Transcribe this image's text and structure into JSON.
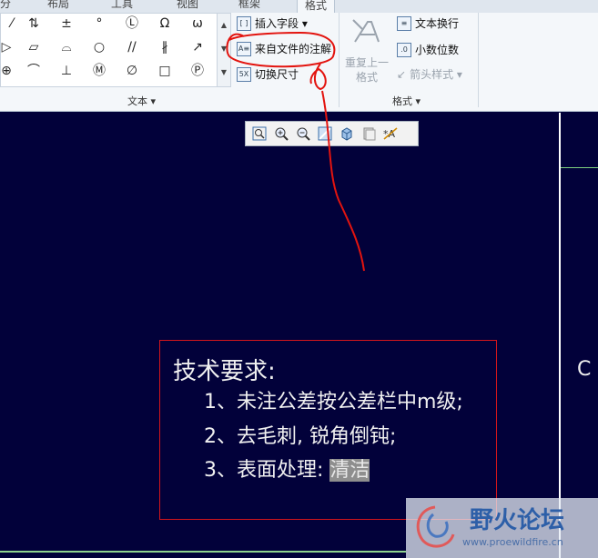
{
  "tabs": [
    "分",
    "布局",
    "工具",
    "视图",
    "框架",
    "格式"
  ],
  "gallery_symbols": [
    [
      "⁄",
      "⇅",
      "±",
      "°",
      "Ⓛ",
      "Ω",
      "ω"
    ],
    [
      "▷",
      "▱",
      "⌓",
      "○",
      "//",
      "∦",
      "↗"
    ],
    [
      "⊕",
      "⌒",
      "⊥",
      "Ⓜ",
      "∅",
      "□",
      "Ⓟ"
    ]
  ],
  "group_text_label": "文本 ▾",
  "group_format_label": "格式 ▾",
  "commands": {
    "insert_field": "插入字段 ▾",
    "note_from_file": "来自文件的注解",
    "toggle_dimension": "切换尺寸",
    "repeat_last_format_1": "重复上一",
    "repeat_last_format_2": "格式",
    "text_wrap": "文本换行",
    "decimal_places": "小数位数",
    "arrow_style": "箭头样式 ▾"
  },
  "note": {
    "title": "技术要求:",
    "line1": "1、未注公差按公差栏中m级;",
    "line2": "2、去毛刺, 锐角倒钝;",
    "line3_prefix": "3、表面处理: ",
    "line3_highlight": "清洁"
  },
  "side_letter": "C",
  "watermark": {
    "name": "野火论坛",
    "url": "www.proewildfire.cn"
  },
  "colors": {
    "canvas": "#02013a",
    "annotation_red": "#d4151b",
    "text": "#f0f0f0"
  }
}
